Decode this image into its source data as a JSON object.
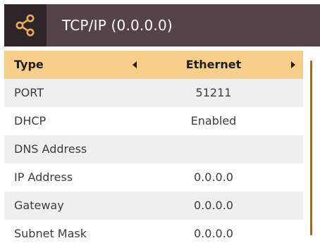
{
  "header": {
    "title": "TCP/IP (0.0.0.0)",
    "icon": "share-icon",
    "icon_color": "#f0a85a",
    "bg_color": "#55434a",
    "icon_bg_color": "#2e2528"
  },
  "rows": [
    {
      "label": "Type",
      "value": "Ethernet",
      "selected": true
    },
    {
      "label": "PORT",
      "value": "51211"
    },
    {
      "label": "DHCP",
      "value": "Enabled"
    },
    {
      "label": "DNS Address",
      "value": ""
    },
    {
      "label": "IP Address",
      "value": "0.0.0.0"
    },
    {
      "label": "Gateway",
      "value": "0.0.0.0"
    },
    {
      "label": "Subnet Mask",
      "value": "0.0.0.0"
    }
  ],
  "colors": {
    "selected_row": "#f7cf8a",
    "alt_row": "#f0efef",
    "scrollbar": "#9a6b2f"
  }
}
